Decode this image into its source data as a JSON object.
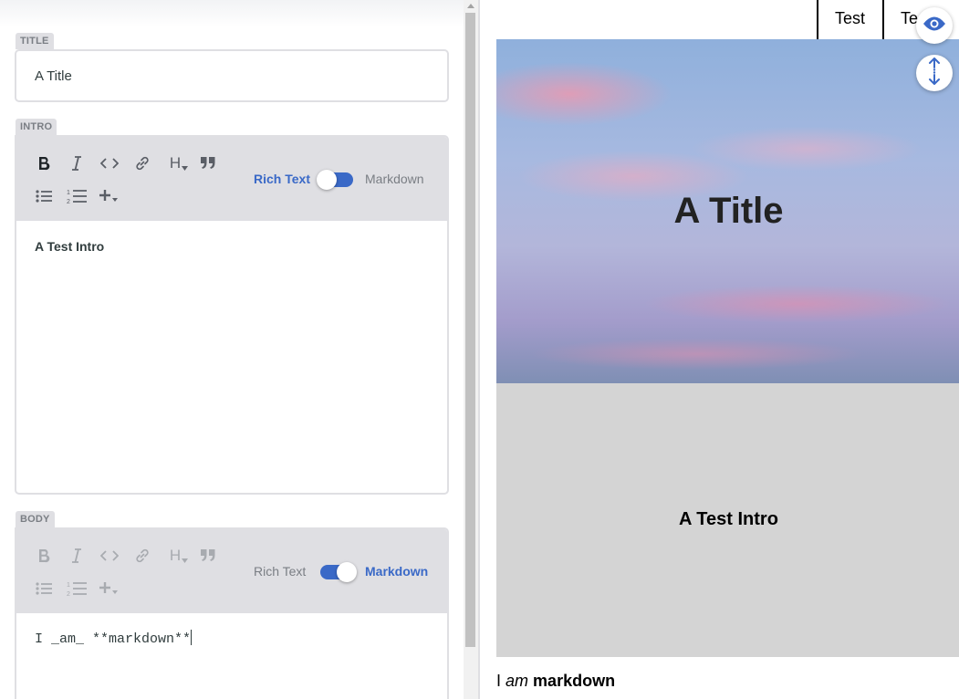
{
  "editor": {
    "title_field": {
      "label": "TITLE",
      "value": "A Title"
    },
    "intro_field": {
      "label": "INTRO",
      "mode_rich": "Rich Text",
      "mode_markdown": "Markdown",
      "active_mode": "Rich Text",
      "content": "A Test Intro"
    },
    "body_field": {
      "label": "BODY",
      "mode_rich": "Rich Text",
      "mode_markdown": "Markdown",
      "active_mode": "Markdown",
      "content": "I _am_ **markdown**"
    },
    "toolbar_icons": [
      "bold-icon",
      "italic-icon",
      "code-icon",
      "link-icon",
      "heading-icon",
      "quote-icon",
      "bulleted-list-icon",
      "numbered-list-icon",
      "add-component-icon"
    ],
    "toolbar_heading_glyph": "H"
  },
  "preview": {
    "nav": [
      "Test",
      "Te"
    ],
    "hero_title": "A Title",
    "intro": "A Test Intro",
    "body": {
      "before": "I ",
      "em": "am",
      "between": " ",
      "strong": "markdown"
    }
  },
  "colors": {
    "accent": "#3a69c7",
    "field_border": "#dfdfe3",
    "toolbar_bg": "#dfdfe3",
    "intro_bg": "#d4d4d4"
  },
  "preview_controls": [
    "eye-icon",
    "sync-scroll-icon"
  ]
}
